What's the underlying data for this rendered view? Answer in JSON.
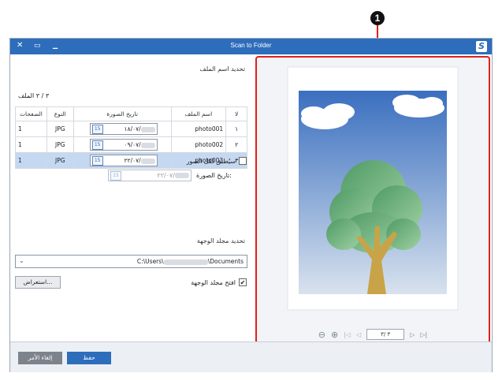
{
  "callout": {
    "number": "1"
  },
  "window": {
    "title": "Scan to Folder",
    "close_glyph": "✕",
    "maximize_glyph": "▭",
    "minimize_glyph": "▁",
    "logo": "S"
  },
  "filename_section": {
    "title": "تحديد اسم الملف"
  },
  "counter": {
    "text": "٣ / ٣ الملف"
  },
  "table": {
    "headers": {
      "number": "لا",
      "filename": "اسم الملف",
      "date": "تاريخ الصورة",
      "type": "النوع",
      "pages": "الصفحات"
    },
    "rows": [
      {
        "number": "١",
        "filename": "photo001",
        "date": "١٨/٠٧/",
        "type": "JPG",
        "pages": "1",
        "selected": false
      },
      {
        "number": "٢",
        "filename": "photo002",
        "date": "٠٩/٠٧/",
        "type": "JPG",
        "pages": "1",
        "selected": false
      },
      {
        "number": "٣",
        "filename": "photo003",
        "date": "٢٢/٠٧/",
        "type": "JPG",
        "pages": "1",
        "selected": true
      }
    ],
    "calendar_label": "15"
  },
  "apply_all": {
    "label": "سيُطبق لكل الصور",
    "checked": false
  },
  "image_date": {
    "label": "تاريخ الصورة:",
    "value": "٢٢/٠٧/"
  },
  "folder_section": {
    "title": "تحديد مجلد الوجهة"
  },
  "folder_path": {
    "prefix": "C:\\Users\\",
    "suffix": "\\Documents"
  },
  "open_folder": {
    "label": "افتح مجلد الوجهة",
    "checked": true
  },
  "browse_button": {
    "label": "استعراض..."
  },
  "save_button": {
    "label": "حفظ"
  },
  "cancel_button": {
    "label": "إلغاء الأمر"
  },
  "nav": {
    "page": "٣ /٣"
  },
  "colors": {
    "title_bar": "#2e6dbb",
    "accent": "#e0201a",
    "selected_row": "#c4d8f2",
    "sky": "#3a6fbf",
    "tree_leaves": "#5aaa6a",
    "trunk": "#c9a348"
  }
}
